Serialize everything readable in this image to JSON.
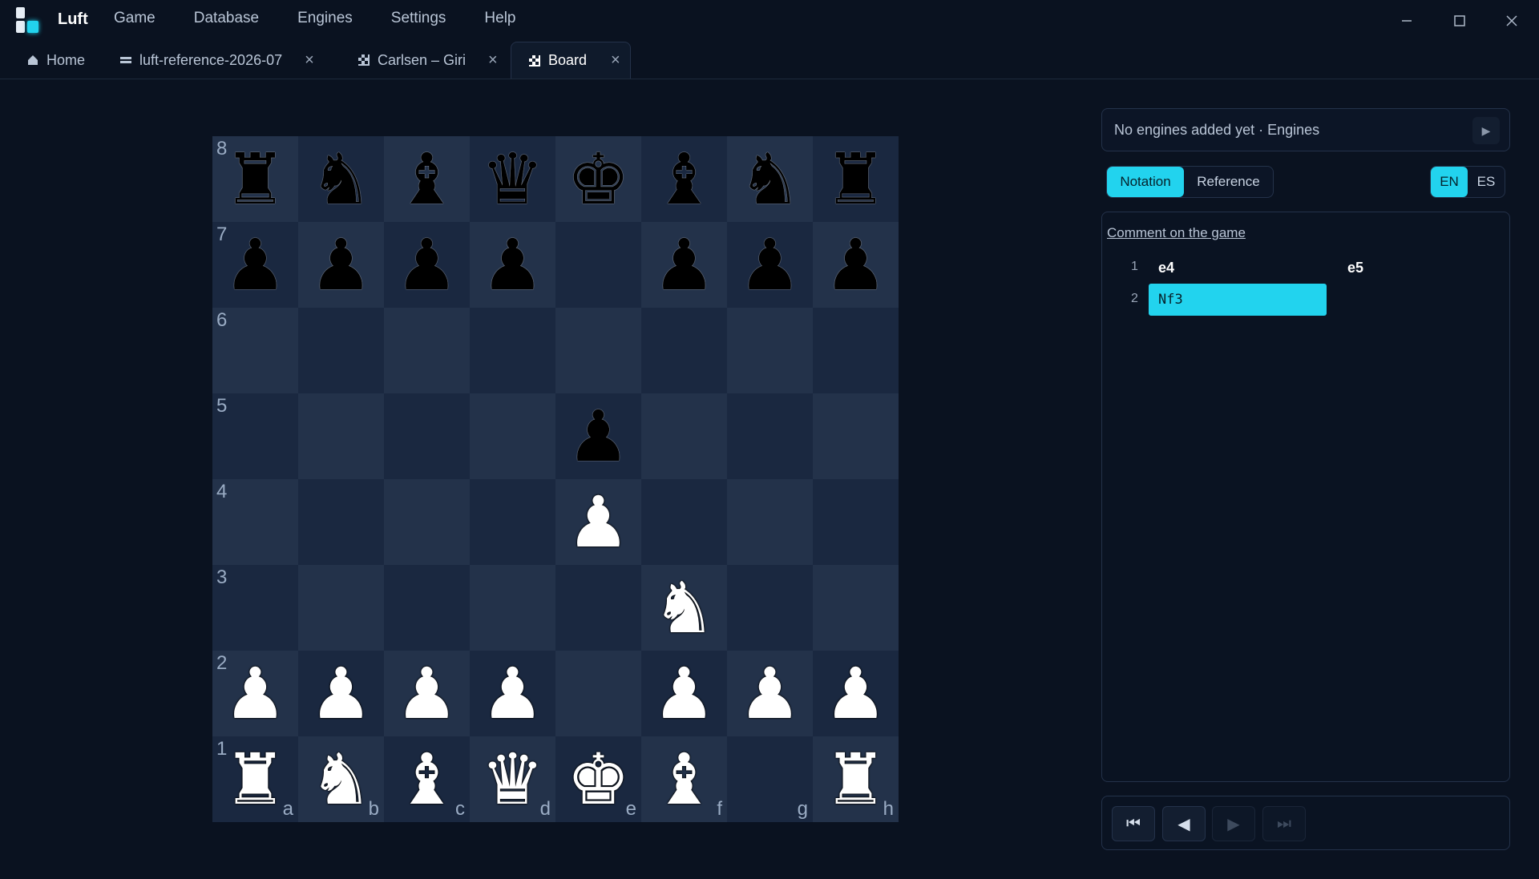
{
  "app": {
    "name": "Luft"
  },
  "menu": [
    "Game",
    "Database",
    "Engines",
    "Settings",
    "Help"
  ],
  "tabs": [
    {
      "label": "Home",
      "icon": "home-icon",
      "closable": false
    },
    {
      "label": "luft-reference-2026-07",
      "icon": "database-icon",
      "closable": true
    },
    {
      "label": "Carlsen – Giri",
      "icon": "board-icon",
      "closable": true
    },
    {
      "label": "Board",
      "icon": "board-icon",
      "closable": true,
      "active": true
    }
  ],
  "board": {
    "files": [
      "a",
      "b",
      "c",
      "d",
      "e",
      "f",
      "g",
      "h"
    ],
    "ranks": [
      "8",
      "7",
      "6",
      "5",
      "4",
      "3",
      "2",
      "1"
    ],
    "position": [
      [
        "r",
        "n",
        "b",
        "q",
        "k",
        "b",
        "n",
        "r"
      ],
      [
        "p",
        "p",
        "p",
        "p",
        "",
        "p",
        "p",
        "p"
      ],
      [
        "",
        "",
        "",
        "",
        "",
        "",
        "",
        ""
      ],
      [
        "",
        "",
        "",
        "",
        "p",
        "",
        "",
        ""
      ],
      [
        "",
        "",
        "",
        "",
        "P",
        "",
        "",
        ""
      ],
      [
        "",
        "",
        "",
        "",
        "",
        "N",
        "",
        ""
      ],
      [
        "P",
        "P",
        "P",
        "P",
        "",
        "P",
        "P",
        "P"
      ],
      [
        "R",
        "N",
        "B",
        "Q",
        "K",
        "B",
        "",
        "R"
      ]
    ]
  },
  "engine": {
    "status": "No engines added yet · Engines"
  },
  "view_tabs": {
    "notation": "Notation",
    "reference": "Reference"
  },
  "language": {
    "en": "EN",
    "es": "ES",
    "selected": "EN"
  },
  "notation": {
    "comment_link": "Comment on the game",
    "moves": [
      {
        "num": "1",
        "white": "e4",
        "black": "e5"
      },
      {
        "num": "2",
        "white": "Nf3",
        "black": ""
      }
    ],
    "selected": "Nf3"
  },
  "colors": {
    "accent": "#22d3ee",
    "bg": "#0a1220",
    "light_square": "#23324a",
    "dark_square": "#1a2840"
  }
}
